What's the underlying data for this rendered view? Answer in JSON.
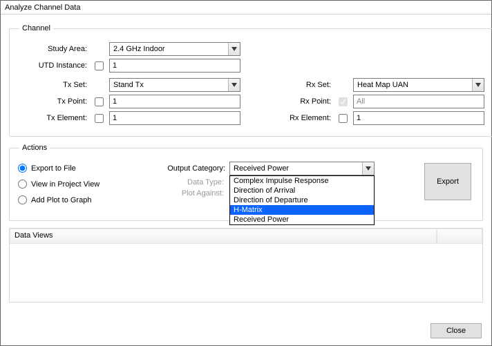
{
  "window": {
    "title": "Analyze Channel Data"
  },
  "channel": {
    "legend": "Channel",
    "study_area": {
      "label": "Study Area:",
      "value": "2.4 GHz Indoor"
    },
    "utd_instance": {
      "label": "UTD Instance:",
      "checked": false,
      "value": "1"
    },
    "tx_set": {
      "label": "Tx Set:",
      "value": "Stand Tx"
    },
    "tx_point": {
      "label": "Tx Point:",
      "checked": false,
      "value": "1"
    },
    "tx_element": {
      "label": "Tx Element:",
      "checked": false,
      "value": "1"
    },
    "rx_set": {
      "label": "Rx Set:",
      "value": "Heat Map UAN"
    },
    "rx_point": {
      "label": "Rx Point:",
      "checked": true,
      "disabled": true,
      "value": "All"
    },
    "rx_element": {
      "label": "Rx Element:",
      "checked": false,
      "value": "1"
    }
  },
  "actions": {
    "legend": "Actions",
    "export_to_file": {
      "label": "Export to File",
      "selected": true
    },
    "view_in_project": {
      "label": "View in Project View",
      "selected": false
    },
    "add_plot_to_graph": {
      "label": "Add Plot to Graph",
      "selected": false
    },
    "output_category": {
      "label": "Output Category:",
      "value": "Received Power"
    },
    "data_type": {
      "label": "Data Type:"
    },
    "plot_against": {
      "label": "Plot Against:"
    },
    "dropdown_options": [
      "Complex Impulse Response",
      "Direction of Arrival",
      "Direction of Departure",
      "H-Matrix",
      "Received Power"
    ],
    "dropdown_selected_index": 3,
    "export_button": "Export"
  },
  "dataviews": {
    "header": "Data Views"
  },
  "footer": {
    "close": "Close"
  }
}
